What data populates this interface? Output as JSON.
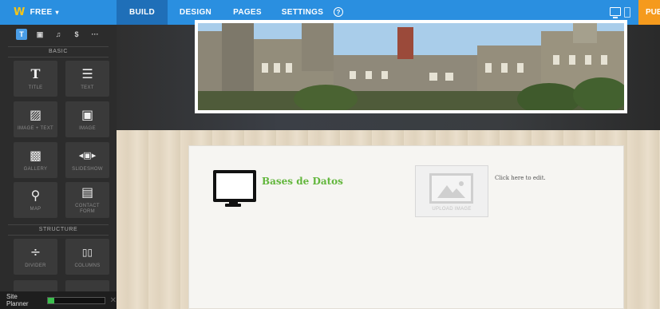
{
  "topbar": {
    "plan_label": "FREE",
    "tabs": [
      {
        "label": "BUILD",
        "active": true
      },
      {
        "label": "DESIGN",
        "active": false
      },
      {
        "label": "PAGES",
        "active": false
      },
      {
        "label": "SETTINGS",
        "active": false
      }
    ],
    "help_glyph": "?",
    "publish_label": "PUBLISH",
    "accent_color": "#2a8fe0",
    "publish_color": "#f59a1d"
  },
  "sidebar": {
    "tools": [
      {
        "icon": "text-tool-icon",
        "glyph": "T"
      },
      {
        "icon": "media-tool-icon",
        "glyph": "▣"
      },
      {
        "icon": "music-tool-icon",
        "glyph": "♫"
      },
      {
        "icon": "commerce-tool-icon",
        "glyph": "$"
      },
      {
        "icon": "more-tool-icon",
        "glyph": "···"
      }
    ],
    "basic_header": "BASIC",
    "basic_elements": [
      {
        "label": "TITLE",
        "icon": "title-icon",
        "glyph": "T"
      },
      {
        "label": "TEXT",
        "icon": "text-icon",
        "glyph": "☰"
      },
      {
        "label": "IMAGE + TEXT",
        "icon": "image-text-icon",
        "glyph": "▨"
      },
      {
        "label": "IMAGE",
        "icon": "image-icon",
        "glyph": "▣"
      },
      {
        "label": "GALLERY",
        "icon": "gallery-icon",
        "glyph": "▩"
      },
      {
        "label": "SLIDESHOW",
        "icon": "slideshow-icon",
        "glyph": "◂▣▸"
      },
      {
        "label": "MAP",
        "icon": "map-icon",
        "glyph": "⚲"
      },
      {
        "label": "CONTACT FORM",
        "icon": "contact-form-icon",
        "glyph": "▤"
      }
    ],
    "structure_header": "STRUCTURE",
    "structure_elements": [
      {
        "label": "DIVIDER",
        "icon": "divider-icon",
        "glyph": "÷"
      },
      {
        "label": "COLUMNS",
        "icon": "columns-icon",
        "glyph": "▯▯"
      }
    ],
    "site_planner": {
      "label": "Site Planner",
      "progress": 0.12,
      "close_glyph": "✕"
    }
  },
  "content": {
    "block_title": "Bases de Datos",
    "upload_label": "UPLOAD IMAGE",
    "click_to_edit": "Click here to edit.",
    "title_color": "#62b63c"
  }
}
